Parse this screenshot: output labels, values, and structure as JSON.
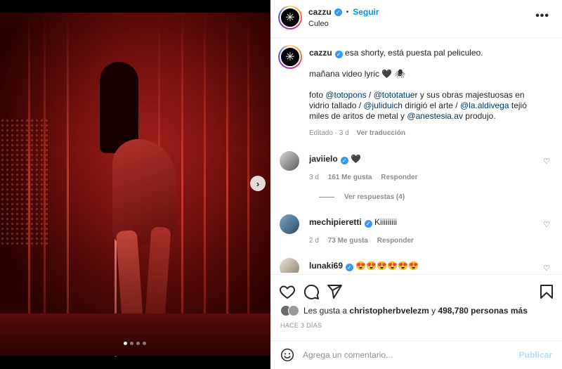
{
  "post": {
    "username": "cazzu",
    "follow_label": "Seguir",
    "location": "Culeo",
    "more_label": "•••",
    "avatar_glyph": "✳"
  },
  "caption": {
    "username": "cazzu",
    "line1": "esa shorty, está puesta pal peliculeo.",
    "line2": "mañana video lyric 🖤 🕷",
    "foto": "foto",
    "m1": "@totopons",
    "sep1": " / ",
    "m2": "@tototatuer",
    "t2": " y sus obras majestuosas en vidrio tallado / ",
    "m3": "@juliduich",
    "t3": " dirigió el arte / ",
    "m4": "@la.aldivega",
    "t4": " tejió miles de aritos de metal y ",
    "m5": "@anestesia.av",
    "t5": " produjo.",
    "edited": "Editado · 3 d",
    "translate": "Ver traducción"
  },
  "comments": [
    {
      "user": "javiielo",
      "text": "🖤",
      "age": "3 d",
      "likes": "161 Me gusta",
      "reply": "Responder",
      "replies": "Ver respuestas (4)"
    },
    {
      "user": "mechipieretti",
      "text": "Kiiiiiiiii",
      "age": "2 d",
      "likes": "73 Me gusta",
      "reply": "Responder"
    },
    {
      "user": "lunaki69",
      "text": "😍😍😍😍😍😍"
    }
  ],
  "likes": {
    "prefix": "Les gusta a",
    "user": "christopherbvelezm",
    "conj": "y",
    "count": "498,780 personas más"
  },
  "time_ago": "HACE 3 DÍAS",
  "comment_box": {
    "placeholder": "Agrega un comentario...",
    "publish_label": "Publicar"
  },
  "carousel": {
    "next_label": "›",
    "slides": 4,
    "active_index": 0
  },
  "colors": {
    "accent": "#0095f6",
    "verified": "#3897f0",
    "publish_disabled": "#b2dffc",
    "mention": "#00376b"
  }
}
